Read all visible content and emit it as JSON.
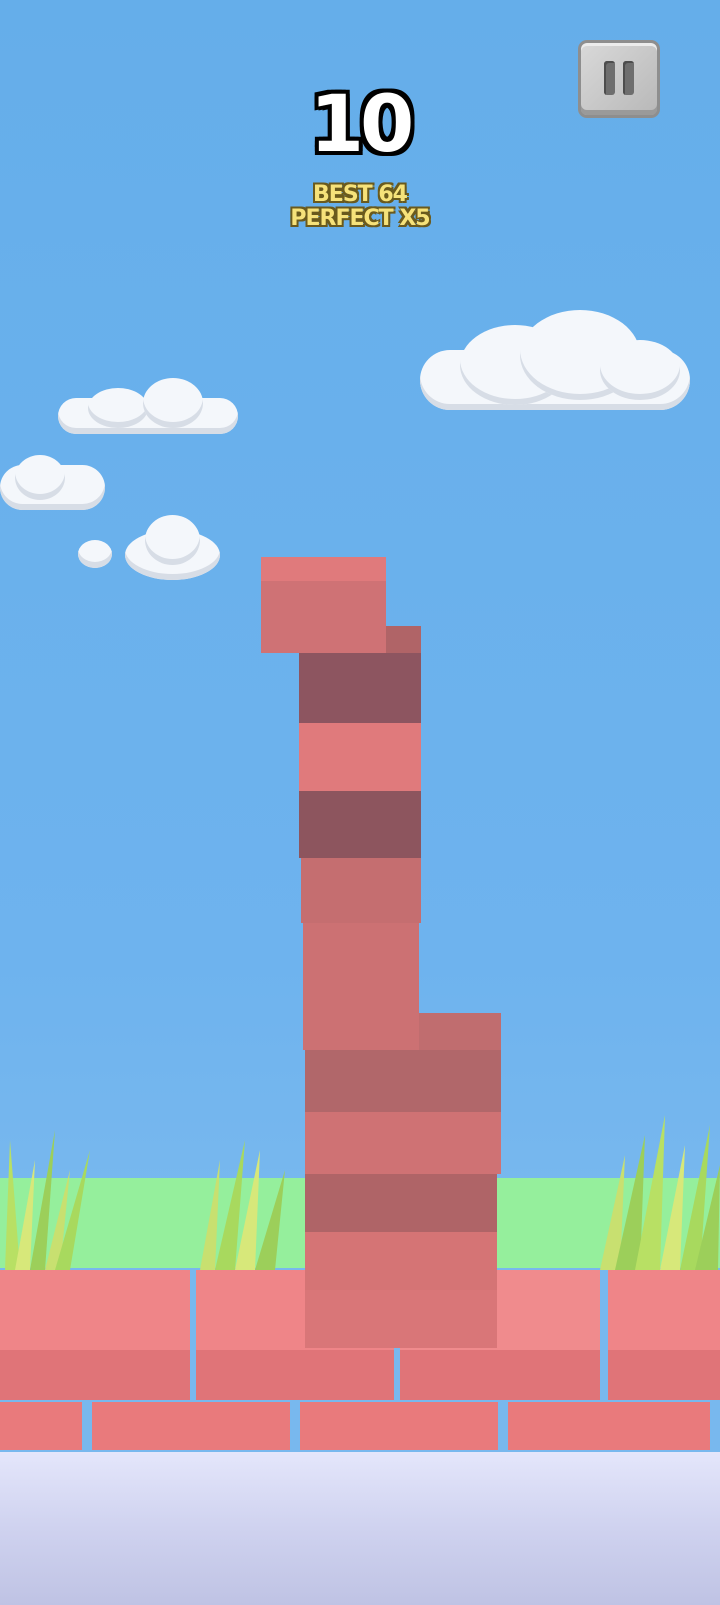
{
  "hud": {
    "score": "10",
    "best": "BEST 64",
    "perfect": "PERFECT X5"
  },
  "icons": {
    "pause": "pause-icon"
  },
  "colors": {
    "sky": "#6eb3ee",
    "block_light": "#e07a7c",
    "block_dark": "#8d555e",
    "grass": "#95ef9c",
    "wall": "#ef8588",
    "floor": "#d6d9f2"
  }
}
